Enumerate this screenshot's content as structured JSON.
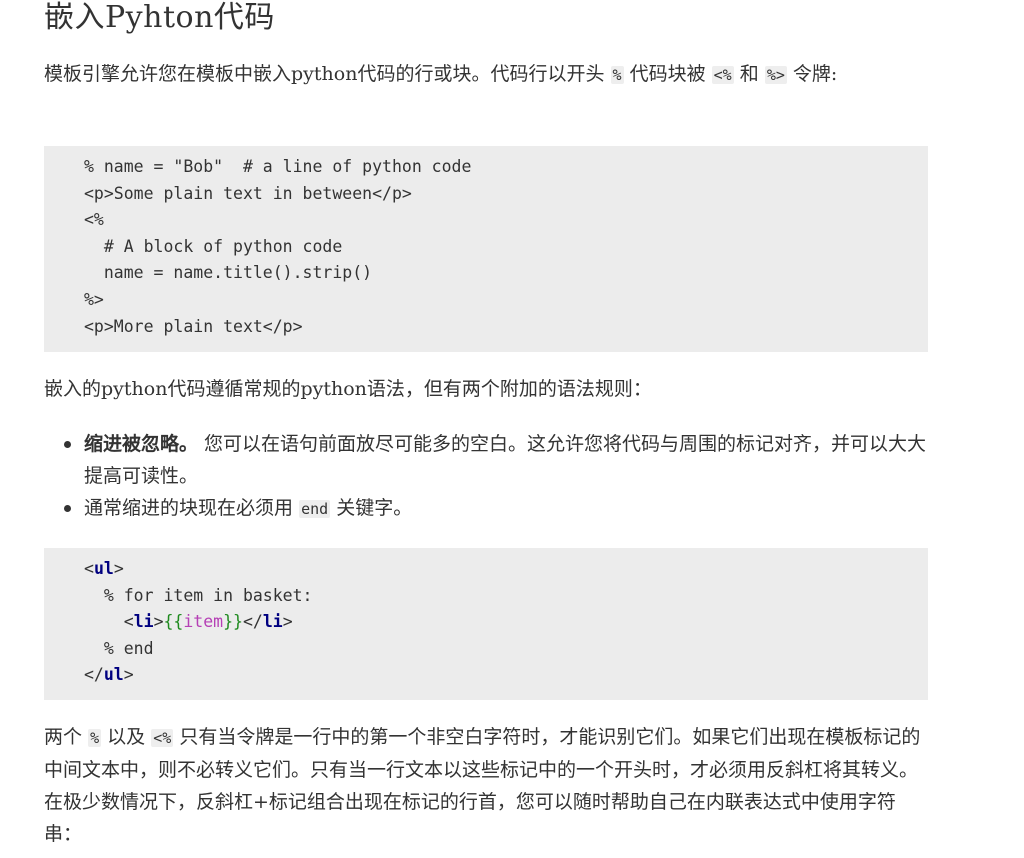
{
  "title": "嵌入Pyhton代码",
  "intro": {
    "text_a": "模板引擎允许您在模板中嵌入python代码的行或块。代码行以开头",
    "code_percent": "%",
    "text_b": "代码块被",
    "code_open": "<%",
    "text_c": "和",
    "code_close": "%>",
    "text_d": "令牌:"
  },
  "code_block_1": {
    "lines": [
      "% name = \"Bob\"  # a line of python code",
      "<p>Some plain text in between</p>",
      "<%",
      "  # A block of python code",
      "  name = name.title().strip()",
      "%>",
      "<p>More plain text</p>"
    ]
  },
  "syntax_intro": "嵌入的python代码遵循常规的python语法，但有两个附加的语法规则：",
  "rules": {
    "rule1_bold": "缩进被忽略。",
    "rule1_text": " 您可以在语句前面放尽可能多的空白。这允许您将代码与周围的标记对齐，并可以大大提高可读性。",
    "rule2_text_a": "通常缩进的块现在必须用",
    "rule2_code": "end",
    "rule2_text_b": "关键字。"
  },
  "code_block_2": {
    "line1_open": "<",
    "line1_tag": "ul",
    "line1_close": ">",
    "line2": "  % for item in basket:",
    "line3_indent": "    ",
    "line3_lt": "<",
    "line3_tag": "li",
    "line3_gt": ">",
    "line3_open_brace": "{{",
    "line3_var": "item",
    "line3_close_brace": "}}",
    "line3_end_lt": "</",
    "line3_end_tag": "li",
    "line3_end_gt": ">",
    "line4": "  % end",
    "line5_open": "</",
    "line5_tag": "ul",
    "line5_close": ">"
  },
  "closing": {
    "text_a": "两个",
    "code_percent": "%",
    "text_b": "以及",
    "code_open": "<%",
    "text_c": "只有当令牌是一行中的第一个非空白字符时，才能识别它们。如果它们出现在模板标记的中间文本中，则不必转义它们。只有当一行文本以这些标记中的一个开头时，才必须用反斜杠将其转义。在极少数情况下，反斜杠+标记组合出现在标记的行首，您可以随时帮助自己在内联表达式中使用字符串："
  }
}
